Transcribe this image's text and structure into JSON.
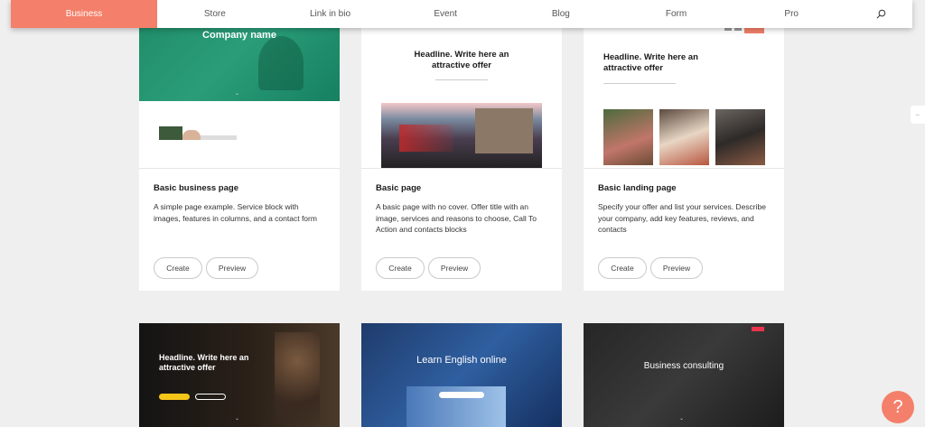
{
  "nav": {
    "items": [
      "Business",
      "Store",
      "Link in bio",
      "Event",
      "Blog",
      "Form",
      "Pro"
    ],
    "active": "Business",
    "search_icon": "search-icon",
    "accent": "#f47f6a"
  },
  "cards": [
    {
      "title": "Basic business page",
      "description": "A simple page example. Service block with images, features in columns, and a contact form",
      "thumb_heading": "Company name",
      "create": "Create",
      "preview": "Preview"
    },
    {
      "title": "Basic page",
      "description": "A basic page with no cover. Offer title with an image, services and reasons to choose, Call To Action and contacts blocks",
      "thumb_heading": "Headline. Write here an attractive offer",
      "create": "Create",
      "preview": "Preview"
    },
    {
      "title": "Basic landing page",
      "description": "Specify your offer and list your services. Describe your company, add key features, reviews, and contacts",
      "thumb_heading": "Headline. Write here an attractive offer",
      "create": "Create",
      "preview": "Preview"
    }
  ],
  "row2": [
    {
      "thumb_heading": "Headline. Write here an attractive offer"
    },
    {
      "thumb_heading": "Learn English online"
    },
    {
      "thumb_heading": "Business consulting"
    }
  ],
  "help": {
    "label": "?"
  }
}
